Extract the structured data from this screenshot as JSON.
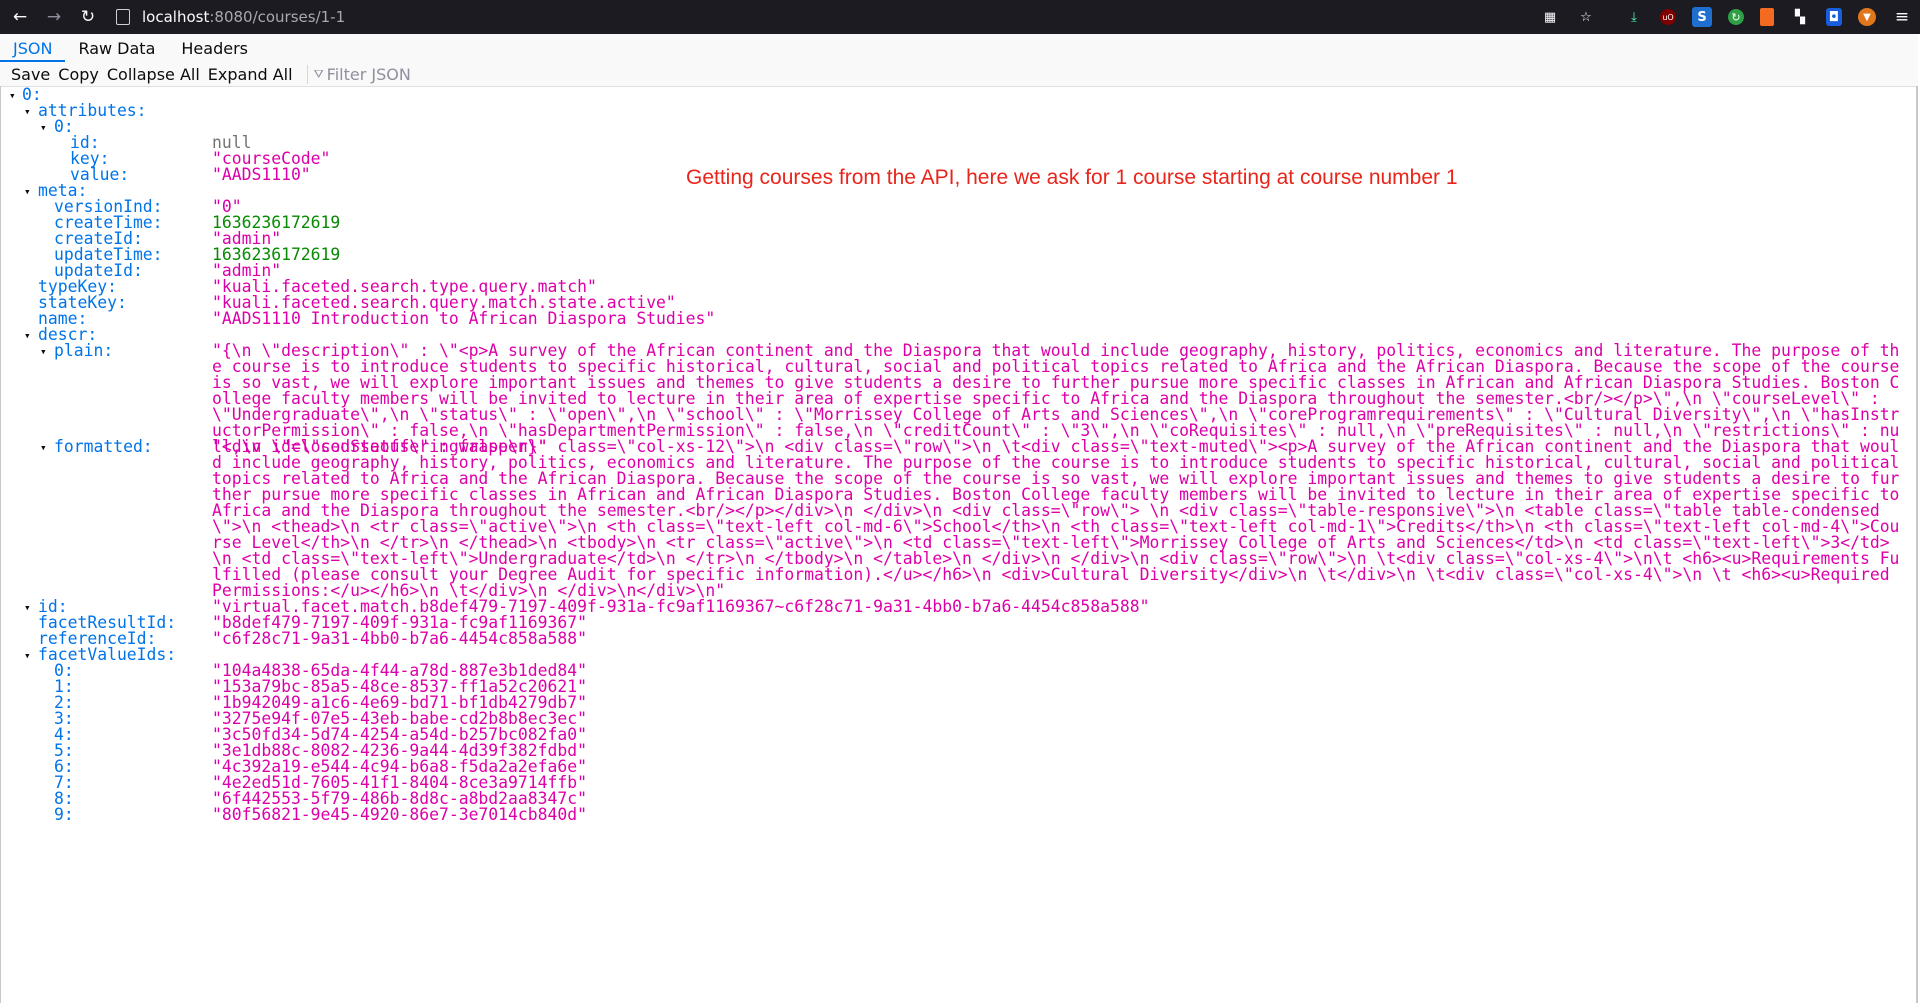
{
  "browser": {
    "url_host": "localhost",
    "url_path": ":8080/courses/1-1"
  },
  "tabs": [
    "JSON",
    "Raw Data",
    "Headers"
  ],
  "toolbar": {
    "save": "Save",
    "copy": "Copy",
    "collapse": "Collapse All",
    "expand": "Expand All",
    "filter_placeholder": "Filter JSON"
  },
  "annotation": "Getting courses from the API, here we ask for 1 course starting at course number 1",
  "json": {
    "root_key": "0:",
    "attributes_key": "attributes:",
    "attr0_key": "0:",
    "id_key": "id:",
    "id_val": "null",
    "key_key": "key:",
    "key_val": "\"courseCode\"",
    "value_key": "value:",
    "value_val": "\"AADS1110\"",
    "meta_key": "meta:",
    "versionInd_key": "versionInd:",
    "versionInd_val": "\"0\"",
    "createTime_key": "createTime:",
    "createTime_val": "1636236172619",
    "createId_key": "createId:",
    "createId_val": "\"admin\"",
    "updateTime_key": "updateTime:",
    "updateTime_val": "1636236172619",
    "updateId_key": "updateId:",
    "updateId_val": "\"admin\"",
    "typeKey_key": "typeKey:",
    "typeKey_val": "\"kuali.faceted.search.type.query.match\"",
    "stateKey_key": "stateKey:",
    "stateKey_val": "\"kuali.faceted.search.query.match.state.active\"",
    "name_key": "name:",
    "name_val": "\"AADS1110 Introduction to African Diaspora Studies\"",
    "descr_key": "descr:",
    "plain_key": "plain:",
    "plain_val": "\"{\\n  \\\"description\\\" : \\\"<p>A survey of the African continent and the Diaspora that would include geography, history, politics, economics and literature. The purpose of the course is to introduce students to specific historical, cultural, social and political topics related to Africa and the African Diaspora. Because the scope of the course is so vast, we will explore important issues and themes to give students a desire to further pursue more specific classes in African and African Diaspora Studies. Boston College faculty members will be invited to lecture in their area of expertise specific to Africa and the Diaspora throughout the semester.<br/></p>\\\",\\n  \\\"courseLevel\\\" : \\\"Undergraduate\\\",\\n  \\\"status\\\" : \\\"open\\\",\\n  \\\"school\\\" : \\\"Morrissey College of Arts and Sciences\\\",\\n  \\\"coreProgramrequirements\\\" : \\\"Cultural Diversity\\\",\\n  \\\"hasInstructorPermission\\\" : false,\\n  \\\"hasDepartmentPermission\\\" : false,\\n  \\\"creditCount\\\" : \\\"3\\\",\\n  \\\"coRequisites\\\" : null,\\n  \\\"preRequisites\\\" : null,\\n  \\\"restrictions\\\" : null,\\n  \\\"closedStatus\\\" : false\\n}\"",
    "formatted_key": "formatted:",
    "formatted_val": "\"<div id=\\\"courseofferingwrapper\\\" class=\\\"col-xs-12\\\">\\n    <div class=\\\"row\\\">\\n  \\t<div class=\\\"text-muted\\\"><p>A survey of the African continent and the Diaspora that would include geography, history, politics, economics and literature. The purpose of the course is to introduce students to specific historical, cultural, social and political topics related to Africa and the African Diaspora. Because the scope of the course is so vast, we will explore important issues and themes to give students a desire to further pursue more specific classes in African and African Diaspora Studies. Boston College faculty members will be invited to lecture in their area of expertise specific to Africa and the Diaspora throughout the semester.<br/></p></div>\\n  </div>\\n  <div class=\\\"row\\\"> \\n    <div class=\\\"table-responsive\\\">\\n      <table class=\\\"table table-condensed\\\">\\n        <thead>\\n          <tr class=\\\"active\\\">\\n            <th class=\\\"text-left col-md-6\\\">School</th>\\n            <th class=\\\"text-left col-md-1\\\">Credits</th>\\n            <th class=\\\"text-left col-md-4\\\">Course Level</th>\\n          </tr>\\n        </thead>\\n        <tbody>\\n          <tr class=\\\"active\\\">\\n            <td class=\\\"text-left\\\">Morrissey College of Arts and Sciences</td>\\n            <td class=\\\"text-left\\\">3</td>\\n            <td class=\\\"text-left\\\">Undergraduate</td>\\n          </tr>\\n        </tbody>\\n      </table>\\n    </div>\\n  </div>\\n  <div class=\\\"row\\\">\\n  \\t<div class=\\\"col-xs-4\\\">\\n\\t  <h6><u>Requirements Fulfilled (please consult your Degree Audit for specific information).</u></h6>\\n        <div>Cultural Diversity</div>\\n  \\t</div>\\n  \\t<div class=\\\"col-xs-4\\\">\\n  \\t  <h6><u>Required Permissions:</u></h6>\\n              \\t</div>\\n  </div>\\n</div>\\n\"",
    "vid_key": "id:",
    "vid_val": "\"virtual.facet.match.b8def479-7197-409f-931a-fc9af1169367~c6f28c71-9a31-4bb0-b7a6-4454c858a588\"",
    "facetResultId_key": "facetResultId:",
    "facetResultId_val": "\"b8def479-7197-409f-931a-fc9af1169367\"",
    "referenceId_key": "referenceId:",
    "referenceId_val": "\"c6f28c71-9a31-4bb0-b7a6-4454c858a588\"",
    "facetValueIds_key": "facetValueIds:",
    "facetValueIds": [
      {
        "k": "0:",
        "v": "\"104a4838-65da-4f44-a78d-887e3b1ded84\""
      },
      {
        "k": "1:",
        "v": "\"153a79bc-85a5-48ce-8537-ff1a52c20621\""
      },
      {
        "k": "2:",
        "v": "\"1b942049-a1c6-4e69-bd71-bf1db4279db7\""
      },
      {
        "k": "3:",
        "v": "\"3275e94f-07e5-43eb-babe-cd2b8b8ec3ec\""
      },
      {
        "k": "4:",
        "v": "\"3c50fd34-5d74-4254-a54d-b257bc082fa0\""
      },
      {
        "k": "5:",
        "v": "\"3e1db88c-8082-4236-9a44-4d39f382fdbd\""
      },
      {
        "k": "6:",
        "v": "\"4c392a19-e544-4c94-b6a8-f5da2a2efa6e\""
      },
      {
        "k": "7:",
        "v": "\"4e2ed51d-7605-41f1-8404-8ce3a9714ffb\""
      },
      {
        "k": "8:",
        "v": "\"6f442553-5f79-486b-8d8c-a8bd2aa8347c\""
      },
      {
        "k": "9:",
        "v": "\"80f56821-9e45-4920-86e7-3e7014cb840d\""
      }
    ]
  }
}
